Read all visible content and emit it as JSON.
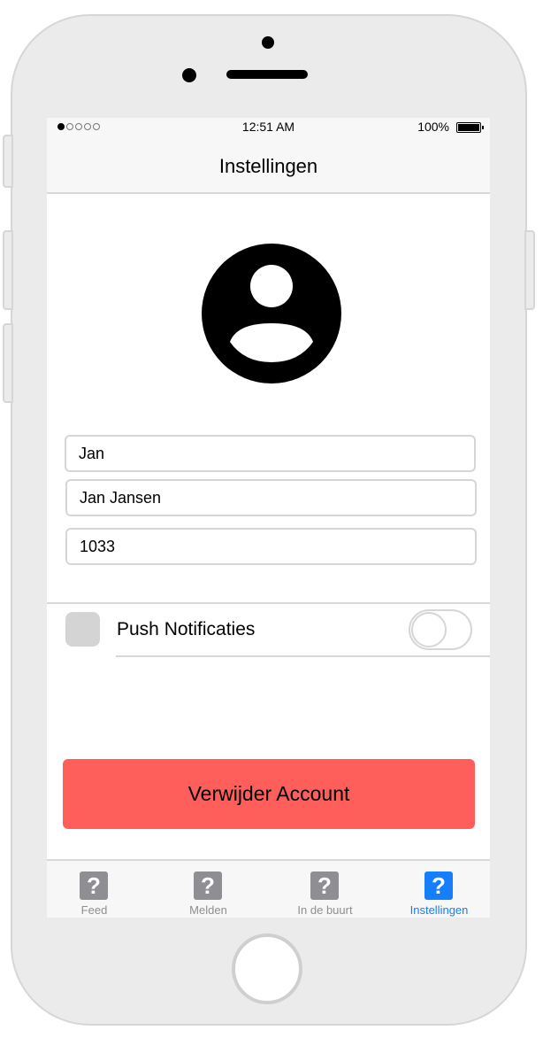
{
  "status_bar": {
    "time": "12:51 AM",
    "battery": "100%",
    "signal_dots_filled": 1,
    "signal_dots_total": 5
  },
  "nav": {
    "title": "Instellingen"
  },
  "profile": {
    "avatar_icon": "user-circle-icon",
    "first_name": "Jan",
    "full_name": "Jan Jansen",
    "postal_code": "1033"
  },
  "settings": {
    "push_label": "Push Notificaties",
    "push_enabled": false
  },
  "actions": {
    "delete_label": "Verwijder Account"
  },
  "tabs": [
    {
      "label": "Feed",
      "icon": "question-mark-icon",
      "active": false
    },
    {
      "label": "Melden",
      "icon": "question-mark-icon",
      "active": false
    },
    {
      "label": "In de buurt",
      "icon": "question-mark-icon",
      "active": false
    },
    {
      "label": "Instellingen",
      "icon": "question-mark-icon",
      "active": true
    }
  ],
  "colors": {
    "accent": "#147efb",
    "danger": "#ff5f5a",
    "inactive": "#8e8e93"
  }
}
